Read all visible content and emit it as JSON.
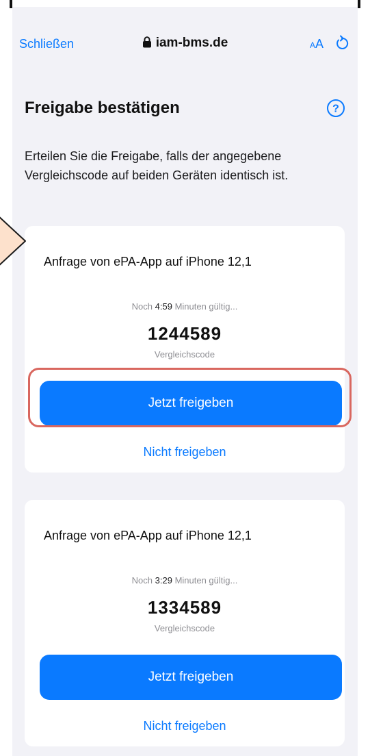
{
  "browser": {
    "close_label": "Schließen",
    "domain": "iam-bms.de",
    "text_size_small": "A",
    "text_size_large": "A",
    "icons": {
      "lock": "lock-icon",
      "reload": "reload-icon",
      "help": "help-icon"
    }
  },
  "page": {
    "title": "Freigabe bestätigen",
    "description": "Erteilen Sie die Freigabe, falls der angegebene Vergleichscode auf beiden Geräten identisch ist."
  },
  "requests": [
    {
      "title": "Anfrage von ePA-App auf iPhone 12,1",
      "timer_prefix": "Noch",
      "timer_value": "4:59",
      "timer_suffix": "Minuten gültig...",
      "code": "1244589",
      "code_label": "Vergleichscode",
      "approve_label": "Jetzt freigeben",
      "decline_label": "Nicht freigeben"
    },
    {
      "title": "Anfrage von ePA-App auf iPhone 12,1",
      "timer_prefix": "Noch",
      "timer_value": "3:29",
      "timer_suffix": "Minuten gültig...",
      "code": "1334589",
      "code_label": "Vergleichscode",
      "approve_label": "Jetzt freigeben",
      "decline_label": "Nicht freigeben"
    }
  ],
  "colors": {
    "accent": "#0a7aff",
    "highlight": "#d9675f",
    "arrow_fill": "#fde1cc"
  }
}
